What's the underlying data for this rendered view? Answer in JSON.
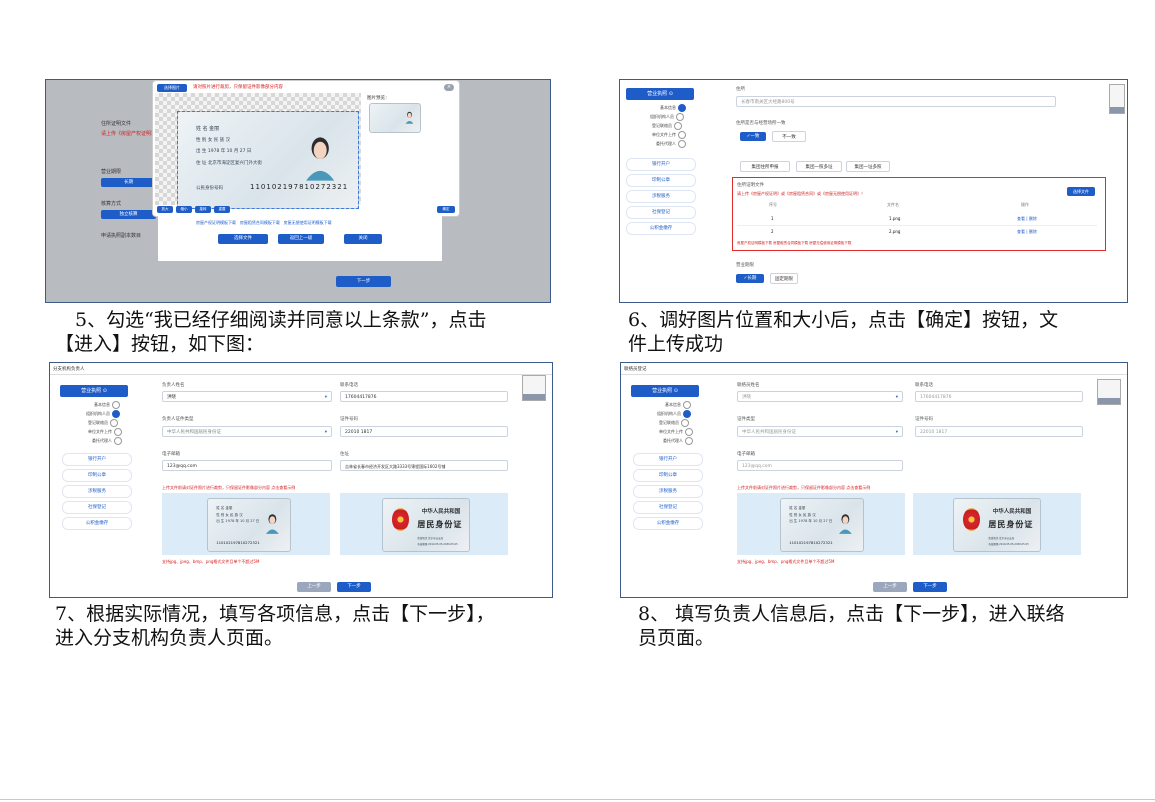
{
  "captions": {
    "c5_line1": "5、勾选“我已经仔细阅读并同意以上条款”，点击",
    "c5_line2": "【进入】按钮，如下图：",
    "c6_line1": "6、调好图片位置和大小后，点击【确定】按钮，文",
    "c6_line2": "件上传成功",
    "c7_line1": "7、根据实际情况，填写各项信息，点击【下一步】，",
    "c7_line2": "进入分支机构负责人页面。",
    "c8_line1": "8、 填写负责人信息后，点击【下一步】，进入联络",
    "c8_line2": "员页面。"
  },
  "shot1": {
    "modal_tag": "选择图片",
    "modal_warning": "请对照片进行裁剪，只保留证件影像部分内容",
    "preview_label": "图片预览：",
    "id_number": "110102197810272321",
    "id_name_line": "姓 名  金丽",
    "id_sex_line": "性 别  女   民 族  汉",
    "id_birth_line": "出 生  1978  年 10 月 27 日",
    "id_addr_line": "住 址  北京市海淀区复兴门外大街",
    "id_num_label": "公民身份号码",
    "tools": [
      "放大",
      "缩小",
      "旋转",
      "重置"
    ],
    "confirm": "确定",
    "download_links": [
      "房屋产权证明模板下载",
      "房屋租赁合同模板下载",
      "房屋无偿使用证明模板下载"
    ],
    "choose_file": "选择文件",
    "back": "返回上一级",
    "close": "关闭",
    "next": "下一步",
    "bg_labels": [
      "住所证明文件",
      "营业期限",
      "核算方式",
      "申请执照副本数目"
    ],
    "bg_red": "请上传《房屋产权证明》",
    "bg_btn": "长期",
    "bg_btn2": "独立核算"
  },
  "shot6": {
    "sidebar_head": "营业执照",
    "sidebar_subs": [
      "基本信息",
      "组织机构人员",
      "登记联络员",
      "单位文件上传",
      "委托代理人"
    ],
    "sidebar_items": [
      "银行开户",
      "印制公章",
      "涉税服务",
      "社保登记",
      "公积金缴存"
    ],
    "addr_label": "住所",
    "addr_placeholder": "长春市南关区大经路800号",
    "same_label": "住所是否与经营场所一致",
    "yes": "✓一致",
    "no": "不一致",
    "opt_btns": [
      "集团住所申报",
      "集团一照多址",
      "集团一址多照"
    ],
    "docs_label": "住所证明文件",
    "docs_warn": "请上传《房屋产权证明》或《房屋租赁合同》或《房屋无偿使用证明》！",
    "upload_btn": "选择文件",
    "cols": [
      "序号",
      "文件名",
      "操作"
    ],
    "rows": [
      [
        "1",
        "1.png",
        "查看 | 删除"
      ],
      [
        "2",
        "2.png",
        "查看 | 删除"
      ]
    ],
    "links": "房屋产权证明模板下载  房屋租赁合同模板下载  房屋无偿使用证明模板下载",
    "period_label": "营业期限",
    "long_term": "✓长期",
    "fixed_term": "固定期限"
  },
  "shot7": {
    "page_title": "分支机构负责人",
    "name_label": "负责人姓名",
    "name_value": "洪晓",
    "phone_label": "联系电话",
    "phone_value": "17604417876",
    "idtype_label": "负责人证件类型",
    "idtype_value": "中华人民共和国居民身份证",
    "idno_label": "证件号码",
    "idno_value": "22010  1817",
    "email_label": "电子邮箱",
    "email_value": "123@qq.com",
    "addr_label": "住址",
    "addr_value": "吉林省长春市经济开发区大路3333号锦程国际1602号铺",
    "warn": "上传文件前请对证件照片进行裁剪，只保留证件影像部分内容 点击查看示例",
    "format_note": "支持jpg、jpeg、bmp、png格式文件且单个不超过5M",
    "prev": "上一步",
    "next": "下一步"
  },
  "shot8": {
    "page_title": "联络员登记",
    "name_label": "联络员姓名",
    "name_value": "洪晓",
    "phone_label": "联系电话",
    "phone_value": "17604417876",
    "idtype_label": "证件类型",
    "idtype_value": "中华人民共和国居民身份证",
    "idno_label": "证件号码",
    "idno_value": "22010  1817",
    "email_label": "电子邮箱",
    "email_value": "123@qq.com",
    "warn": "上传文件前请对证件照片进行裁剪，只保留证件影像部分内容 点击查看示例",
    "format_note": "支持jpg、jpeg、bmp、png格式文件且单个不超过5M",
    "prev": "上一步",
    "next": "下一步"
  },
  "national_card": {
    "title": "中华人民共和国",
    "name": "居民身份证",
    "authority": "签发机关  北京市公安局",
    "validity": "有效期限  2010.05.05-2030.05.05"
  },
  "colors": {
    "primary": "#1e5cc8",
    "danger": "#d42020",
    "border": "#3c5a8a"
  }
}
